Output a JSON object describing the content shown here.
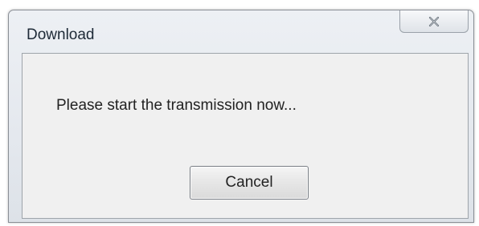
{
  "window": {
    "title": "Download",
    "close_icon": "close-icon"
  },
  "dialog": {
    "message": "Please start the transmission now...",
    "cancel_label": "Cancel"
  },
  "colors": {
    "frame": "#e4e8ee",
    "client": "#f0f0f0",
    "text": "#222222"
  }
}
